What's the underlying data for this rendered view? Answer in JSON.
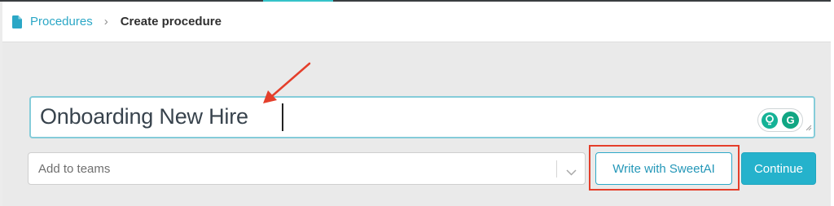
{
  "breadcrumb": {
    "parent": "Procedures",
    "separator": "›",
    "current": "Create procedure"
  },
  "procedure": {
    "title_value": "Onboarding New Hire"
  },
  "grammarly": {
    "letter": "G"
  },
  "teams": {
    "placeholder": "Add to teams"
  },
  "actions": {
    "write_with_ai_label": "Write with SweetAI",
    "continue_label": "Continue"
  },
  "colors": {
    "accent": "#2ba7c6",
    "primary_button": "#25b2cc",
    "annotation": "#e43f2b",
    "grammarly_green": "#11a683"
  },
  "icons": {
    "breadcrumb": "document-icon",
    "dropdown": "chevron-down-icon",
    "grammarly_tip": "lightbulb-icon",
    "grammarly": "grammarly-icon",
    "annotation": "annotation-arrow"
  }
}
